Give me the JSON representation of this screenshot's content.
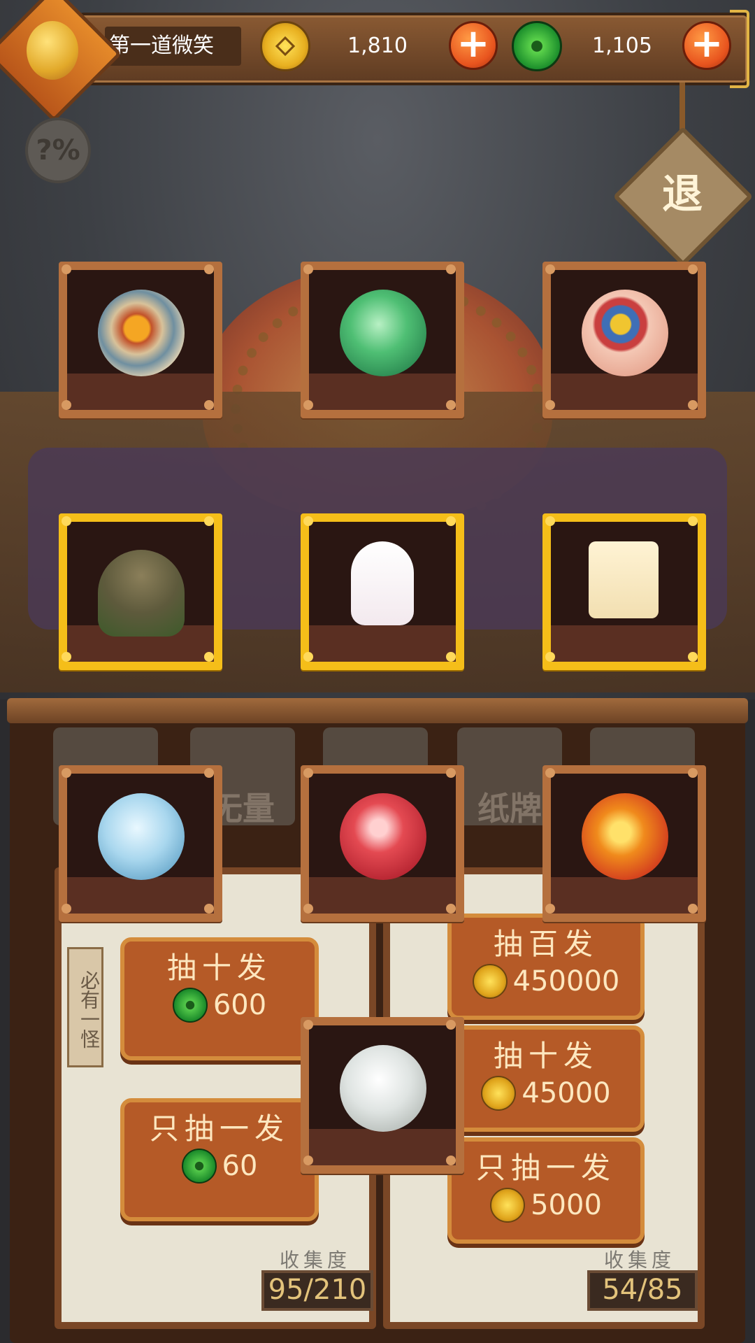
{
  "header": {
    "player_name": "第一道微笑",
    "coins": "1,810",
    "jade": "1,105",
    "add_symbol": "+"
  },
  "buttons": {
    "help": "?%",
    "exit": "退"
  },
  "items": {
    "row1": [
      "crystal-orb",
      "jade-tower-orb",
      "gem-cushion-orb"
    ],
    "row2": [
      "turtle-shell-monster",
      "ghost-monster",
      "tofu-monster"
    ],
    "row3": [
      "snowflake-orb",
      "red-wings-orb",
      "fire-heart-orb"
    ],
    "single": "tornado-orb"
  },
  "tabs": [
    "",
    "无量",
    "",
    "纸牌",
    ""
  ],
  "left_panel": {
    "tag": "必有一怪",
    "draw_ten_label": "抽十发",
    "draw_ten_cost": "600",
    "draw_one_label": "只抽一发",
    "draw_one_cost": "60",
    "collect_label": "收集度",
    "collect_value": "95/210"
  },
  "right_panel": {
    "draw_hundred_label": "抽百发",
    "draw_hundred_cost": "450000",
    "draw_ten_label": "抽十发",
    "draw_ten_cost": "45000",
    "draw_one_label": "只抽一发",
    "draw_one_cost": "5000",
    "collect_label": "收集度",
    "collect_value": "54/85"
  },
  "colors": {
    "wood": "#b5703e",
    "gold_frame": "#f5be19",
    "button": "#b55a27",
    "panel": "#e8e3d3"
  }
}
